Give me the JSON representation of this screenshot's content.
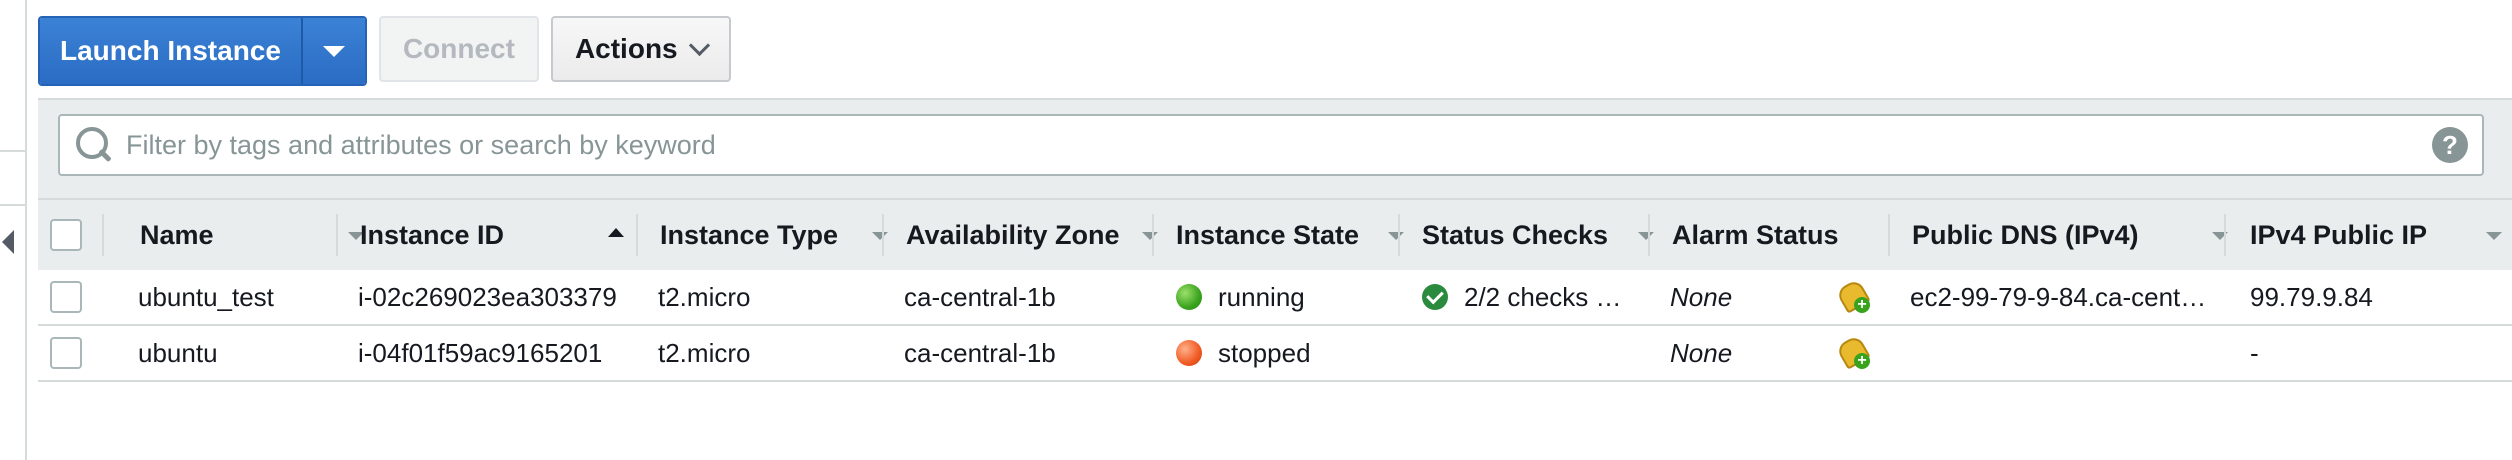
{
  "toolbar": {
    "launch_label": "Launch Instance",
    "connect_label": "Connect",
    "actions_label": "Actions"
  },
  "search": {
    "placeholder": "Filter by tags and attributes or search by keyword",
    "help": "?"
  },
  "table": {
    "columns": [
      "Name",
      "Instance ID",
      "Instance Type",
      "Availability Zone",
      "Instance State",
      "Status Checks",
      "Alarm Status",
      "Public DNS (IPv4)",
      "IPv4 Public IP"
    ],
    "sorted_column": "Instance ID",
    "sort_direction": "ascending",
    "rows": [
      {
        "name": "ubuntu_test",
        "instance_id": "i-02c269023ea303379",
        "instance_type": "t2.micro",
        "availability_zone": "ca-central-1b",
        "instance_state": "running",
        "state_color": "#3aa31e",
        "status_checks": "2/2 checks …",
        "alarm_status": "None",
        "public_dns": "ec2-99-79-9-84.ca-cent…",
        "public_ip": "99.79.9.84"
      },
      {
        "name": "ubuntu",
        "instance_id": "i-04f01f59ac9165201",
        "instance_type": "t2.micro",
        "availability_zone": "ca-central-1b",
        "instance_state": "stopped",
        "state_color": "#f05a23",
        "status_checks": "",
        "alarm_status": "None",
        "public_dns": "",
        "public_ip": "-"
      }
    ]
  },
  "colors": {
    "primary_button": "#2b6cc4",
    "header_background": "#eaeded"
  }
}
